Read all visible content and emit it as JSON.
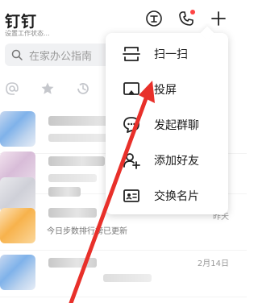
{
  "header": {
    "title": "钉钉",
    "subtitle": "设置工作状态...",
    "notification_color": "#ff4444",
    "icons": [
      "ding-icon",
      "phone-icon",
      "plus-icon"
    ]
  },
  "search": {
    "placeholder": "在家办公指南"
  },
  "filters": [
    "at-icon",
    "star-icon",
    "history-icon"
  ],
  "chats": [
    {
      "avatar": "blurred",
      "name": "",
      "message": "",
      "time": ""
    },
    {
      "avatar": "blurred",
      "name": "",
      "message": "",
      "time": ""
    },
    {
      "avatar": "blurred",
      "name": "",
      "message": "",
      "time": ""
    },
    {
      "avatar": "blurred",
      "name": "",
      "message": "今日步数排行榜已更新",
      "time": "昨天"
    },
    {
      "avatar": "blurred",
      "name": "",
      "message": "",
      "time": "2月14日"
    }
  ],
  "menu": {
    "items": [
      {
        "label": "扫一扫",
        "icon": "scan-icon"
      },
      {
        "label": "投屏",
        "icon": "screen-cast-icon"
      },
      {
        "label": "发起群聊",
        "icon": "group-chat-icon"
      },
      {
        "label": "添加好友",
        "icon": "add-friend-icon"
      },
      {
        "label": "交换名片",
        "icon": "business-card-icon"
      }
    ]
  },
  "annotation": {
    "arrow_color": "#e8302a",
    "points_to": "投屏"
  }
}
